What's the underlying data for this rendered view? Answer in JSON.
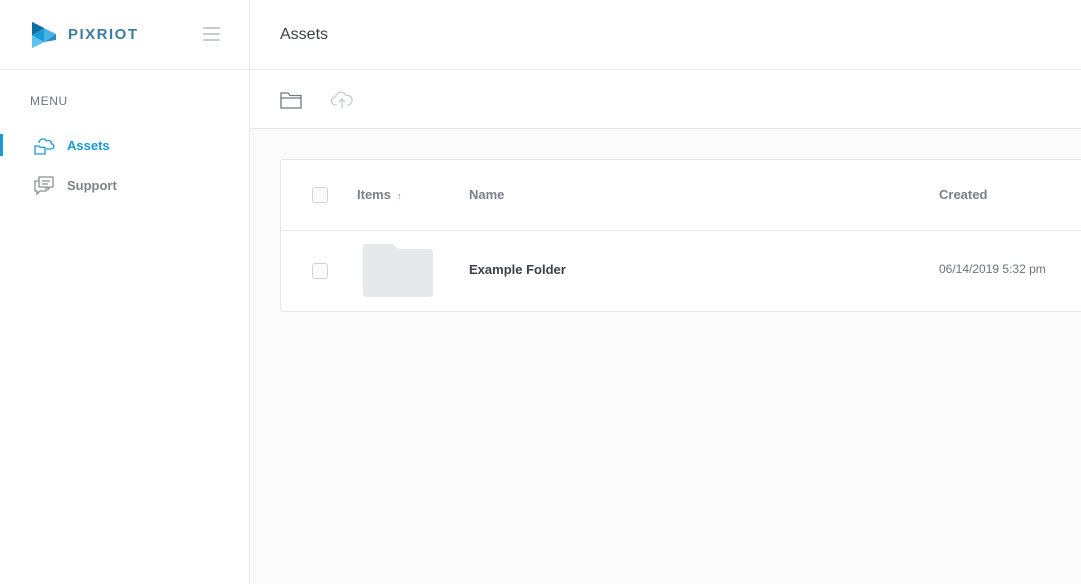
{
  "brand": {
    "name": "PIXRIOT",
    "accent_color": "#1a9ad6"
  },
  "sidebar": {
    "menu_label": "MENU",
    "items": [
      {
        "label": "Assets",
        "icon": "cloud-folder-icon",
        "active": true
      },
      {
        "label": "Support",
        "icon": "chat-bubbles-icon",
        "active": false
      }
    ]
  },
  "header": {
    "title": "Assets"
  },
  "toolbar": {
    "actions": [
      {
        "icon": "folder-icon",
        "enabled": true
      },
      {
        "icon": "cloud-upload-icon",
        "enabled": false
      }
    ]
  },
  "table": {
    "columns": {
      "items": "Items",
      "items_sort": "↑",
      "name": "Name",
      "created": "Created"
    },
    "rows": [
      {
        "thumbnail": "folder-thumbnail-icon",
        "name": "Example Folder",
        "created": "06/14/2019 5:32 pm"
      }
    ]
  }
}
